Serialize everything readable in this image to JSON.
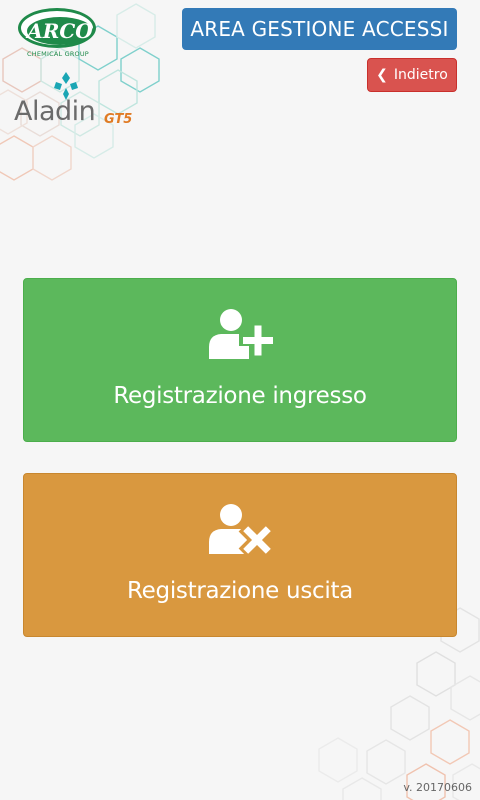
{
  "brand": {
    "arco_logo_text": "ARCO",
    "arco_logo_subtext": "CHEMICAL GROUP",
    "aladin_logo_text": "Aladin",
    "aladin_logo_suffix": "GT5"
  },
  "header": {
    "title": "AREA GESTIONE ACCESSI",
    "back_label": "Indietro",
    "back_icon": "chevron-left-icon"
  },
  "actions": {
    "entry": {
      "label": "Registrazione ingresso",
      "icon": "user-plus-icon"
    },
    "exit": {
      "label": "Registrazione uscita",
      "icon": "user-times-icon"
    }
  },
  "footer": {
    "version": "v. 20170606"
  },
  "colors": {
    "title_bg": "#337ab7",
    "back_bg": "#d9534f",
    "entry_bg": "#5cb85c",
    "exit_bg": "#d9983f",
    "background": "#f6f6f6"
  }
}
